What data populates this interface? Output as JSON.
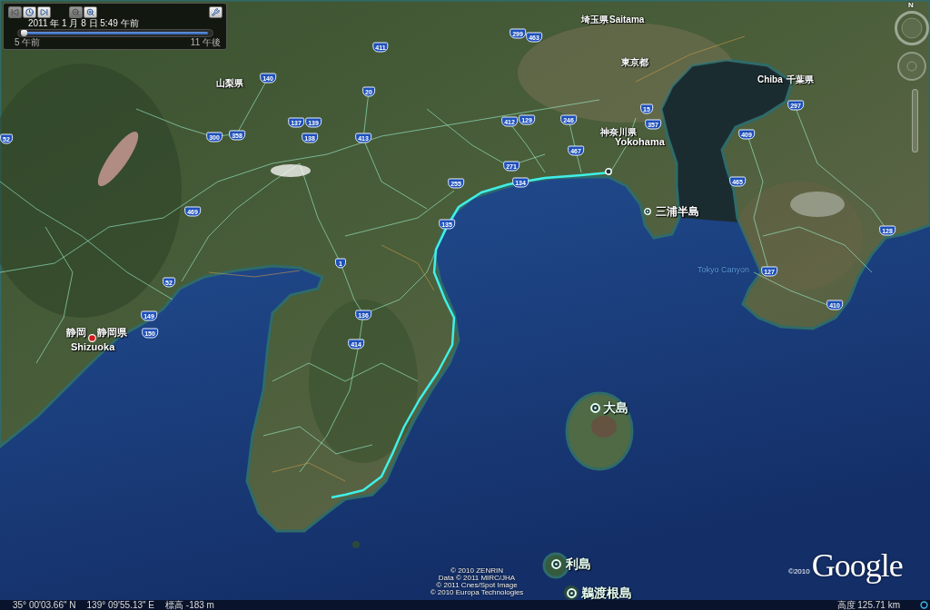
{
  "time_slider": {
    "buttons": [
      {
        "kind": "step_back",
        "disabled": true
      },
      {
        "kind": "clock",
        "disabled": false
      },
      {
        "kind": "step_forward",
        "disabled": false
      },
      {
        "kind": "zoom_out",
        "disabled": true
      },
      {
        "kind": "zoom_in",
        "disabled": false
      },
      {
        "kind": "settings",
        "disabled": false
      }
    ],
    "date_time": "2011 年 1 月 8 日 5:49 午前",
    "level": 0.02,
    "start_label": "5 午前",
    "end_label": "11 午後"
  },
  "navigation": {
    "compass_label": "N"
  },
  "place_labels": [
    {
      "kind": "region",
      "text": "埼玉県",
      "marker": false
    },
    {
      "kind": "region",
      "text": "Saitama",
      "marker": false
    },
    {
      "kind": "region",
      "text": "東京都",
      "marker": false
    },
    {
      "kind": "region",
      "text": "山梨県",
      "marker": false
    },
    {
      "kind": "region",
      "text": "Chiba",
      "marker": false
    },
    {
      "kind": "region",
      "text": "千葉県",
      "marker": false
    },
    {
      "kind": "region",
      "text": "神奈川県",
      "marker": false
    },
    {
      "kind": "city",
      "text": "Yokohama",
      "marker": false
    },
    {
      "kind": "peninsula",
      "text": "三浦半島",
      "marker": true
    },
    {
      "kind": "feature",
      "text": "Tokyo Canyon",
      "marker": false
    },
    {
      "kind": "city",
      "text": "静岡",
      "marker": false
    },
    {
      "kind": "city",
      "text": "静岡県",
      "marker": false
    },
    {
      "kind": "city",
      "text": "Shizuoka",
      "marker": true
    },
    {
      "kind": "island",
      "text": "大島",
      "marker": true
    },
    {
      "kind": "island",
      "text": "利島",
      "marker": true
    },
    {
      "kind": "island",
      "text": "鵜渡根島",
      "marker": true
    }
  ],
  "road_shields": [
    {
      "number": "299"
    },
    {
      "number": "463"
    },
    {
      "number": "411"
    },
    {
      "number": "140"
    },
    {
      "number": "20"
    },
    {
      "number": "15"
    },
    {
      "number": "297"
    },
    {
      "number": "137"
    },
    {
      "number": "139"
    },
    {
      "number": "412"
    },
    {
      "number": "129"
    },
    {
      "number": "246"
    },
    {
      "number": "357"
    },
    {
      "number": "52"
    },
    {
      "number": "300"
    },
    {
      "number": "358"
    },
    {
      "number": "138"
    },
    {
      "number": "413"
    },
    {
      "number": "409"
    },
    {
      "number": "467"
    },
    {
      "number": "271"
    },
    {
      "number": "255"
    },
    {
      "number": "134"
    },
    {
      "number": "465"
    },
    {
      "number": "469"
    },
    {
      "number": "135"
    },
    {
      "number": "128"
    },
    {
      "number": "1"
    },
    {
      "number": "127"
    },
    {
      "number": "52"
    },
    {
      "number": "410"
    },
    {
      "number": "149"
    },
    {
      "number": "136"
    },
    {
      "number": "150"
    },
    {
      "number": "414"
    }
  ],
  "attribution": [
    "© 2010 ZENRIN",
    "Data © 2011 MIRC/JHA",
    "© 2011 Cnes/Spot Image",
    "© 2010 Europa Technologies"
  ],
  "logo": {
    "copyright": "©2010",
    "name": "Google"
  },
  "status_bar": {
    "latitude": "35° 00'03.66\" N",
    "longitude": "139° 09'55.13\" E",
    "elevation": "標高 -183 m",
    "altitude": "高度 125.71 km"
  }
}
